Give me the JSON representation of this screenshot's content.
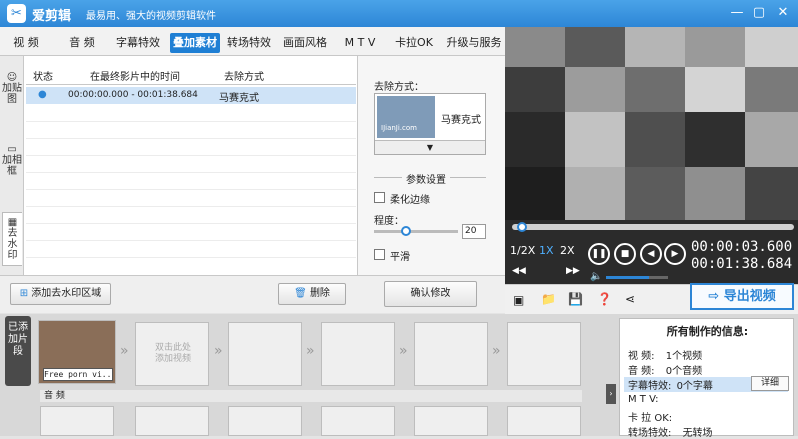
{
  "title_bar": {
    "app_name": "爱剪辑",
    "slogan": "最易用、强大的视频剪辑软件",
    "logo_text": "✂",
    "minimize": "—",
    "maximize": "▢",
    "close": "✕"
  },
  "menu": [
    "视 频",
    "音 频",
    "字幕特效",
    "叠加素材",
    "转场特效",
    "画面风格",
    "M T V",
    "卡拉OK",
    "升级与服务"
  ],
  "active_menu_index": 3,
  "side_tabs": [
    {
      "label": "加贴图",
      "icon": "sticker-icon"
    },
    {
      "label": "加相框",
      "icon": "frame-icon"
    },
    {
      "label": "去水印",
      "icon": "watermark-icon"
    }
  ],
  "list": {
    "columns": [
      "状态",
      "在最终影片中的时间",
      "去除方式"
    ],
    "rows": [
      {
        "status": "●",
        "time": "00:00:00.000 - 00:01:38.684",
        "method": "马赛克式"
      }
    ]
  },
  "settings": {
    "removal_label": "去除方式：",
    "method_name": "马赛克式",
    "thumb_caption": "IJianJi.com",
    "param_title": "参数设置",
    "soften_edge": "柔化边缘",
    "degree_label": "程度：",
    "degree_value": "20",
    "smooth": "平滑",
    "dropdown_arrow": "▼"
  },
  "left_toolbar": {
    "add_region": "添加去水印区域",
    "delete": "删除",
    "confirm": "确认修改"
  },
  "player": {
    "speed_options": [
      "1/2X",
      "1X",
      "2X"
    ],
    "selected_speed": "1X",
    "current_time": "00:00:03.600",
    "total_time": "00:01:38.684",
    "volume_level": 0.7,
    "progress": 0.02,
    "export_label": "导出视频"
  },
  "timeline": {
    "added_tab": "已添加片段",
    "clip_caption": "Free porn vi...",
    "empty_hint": "双击此处\n添加视频",
    "audio_label": "音 频"
  },
  "info_panel": {
    "title": "所有制作的信息:",
    "rows": [
      {
        "key": "视 频:",
        "value": "1个视频"
      },
      {
        "key": "音 频:",
        "value": "0个音频"
      },
      {
        "key": "字幕特效:",
        "value": "0个字幕"
      },
      {
        "key": "M T V:",
        "value": ""
      },
      {
        "key": "卡 拉 OK:",
        "value": ""
      },
      {
        "key": "转场特效:",
        "value": "无转场"
      }
    ],
    "detail_button": "详细"
  },
  "colors": {
    "accent": "#2d86d6",
    "active_tab": "#1f7fd4",
    "selection": "#cfe3f7"
  }
}
